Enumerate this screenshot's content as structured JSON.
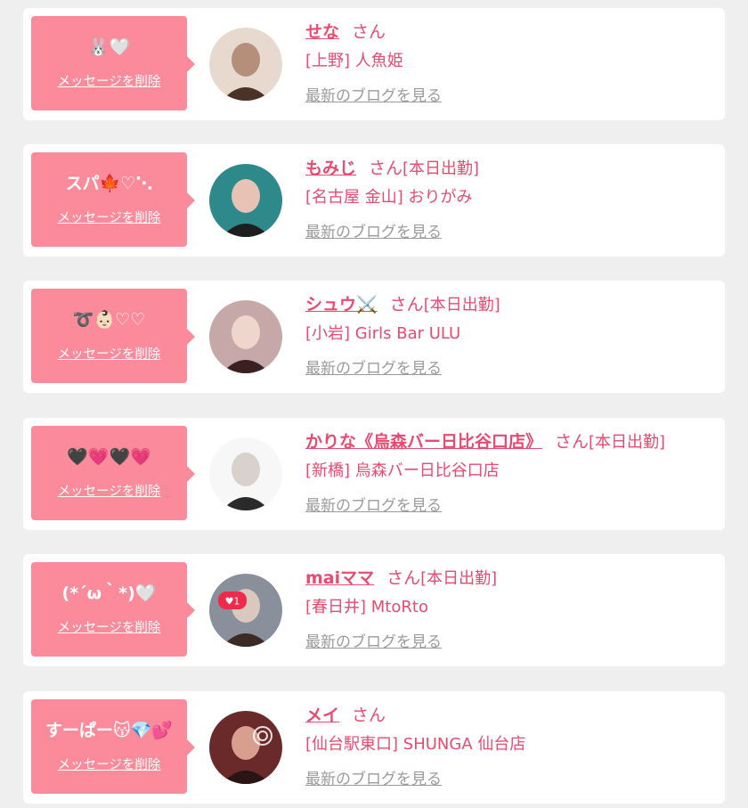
{
  "cards": [
    {
      "status": "🐰🤍",
      "delete_label": "メッセージを削除",
      "name": "せな",
      "san": "さん",
      "today": "",
      "area": "[上野]",
      "shop": "人魚姫",
      "blog_label": "最新のブログを見る",
      "avatar_colors": [
        "#e8d9cf",
        "#b68f7a",
        "#4a3228"
      ]
    },
    {
      "status": "スパ🍁♡⋱",
      "delete_label": "メッセージを削除",
      "name": "もみじ",
      "san": "さん",
      "today": "[本日出勤]",
      "area": "[名古屋 金山]",
      "shop": "おりがみ",
      "blog_label": "最新のブログを見る",
      "avatar_colors": [
        "#2e8a8a",
        "#e8c2b4",
        "#1e1e1e"
      ]
    },
    {
      "status": "➰👶🏻♡♡",
      "delete_label": "メッセージを削除",
      "name": "シュウ⚔️",
      "san": "さん",
      "today": "[本日出勤]",
      "area": "[小岩]",
      "shop": "Girls Bar ULU",
      "blog_label": "最新のブログを見る",
      "avatar_colors": [
        "#c7a8a8",
        "#efd6cc",
        "#3a2020"
      ]
    },
    {
      "status": "🖤💗🖤💗",
      "delete_label": "メッセージを削除",
      "name": "かりな《烏森バー日比谷口店》",
      "san": "さん",
      "today": "[本日出勤]",
      "area": "[新橋]",
      "shop": "烏森バー日比谷口店",
      "blog_label": "最新のブログを見る",
      "avatar_colors": [
        "#f7f7f7",
        "#d9d2cc",
        "#2a2a2a"
      ]
    },
    {
      "status": "(*´ω｀*)🤍",
      "delete_label": "メッセージを削除",
      "name": "maiママ",
      "san": "さん",
      "today": "[本日出勤]",
      "area": "[春日井]",
      "shop": "MtoRto",
      "blog_label": "最新のブログを見る",
      "avatar_colors": [
        "#8a8f9c",
        "#d8c8be",
        "#3c2a24"
      ],
      "like_badge": "♥1"
    },
    {
      "status": "すーぱー😽💎💕",
      "delete_label": "メッセージを削除",
      "name": "メイ",
      "san": "さん",
      "today": "",
      "area": "[仙台駅東口]",
      "shop": "SHUNGA 仙台店",
      "blog_label": "最新のブログを見る",
      "avatar_colors": [
        "#6a2a2a",
        "#d89e8e",
        "#2a1414"
      ]
    }
  ]
}
